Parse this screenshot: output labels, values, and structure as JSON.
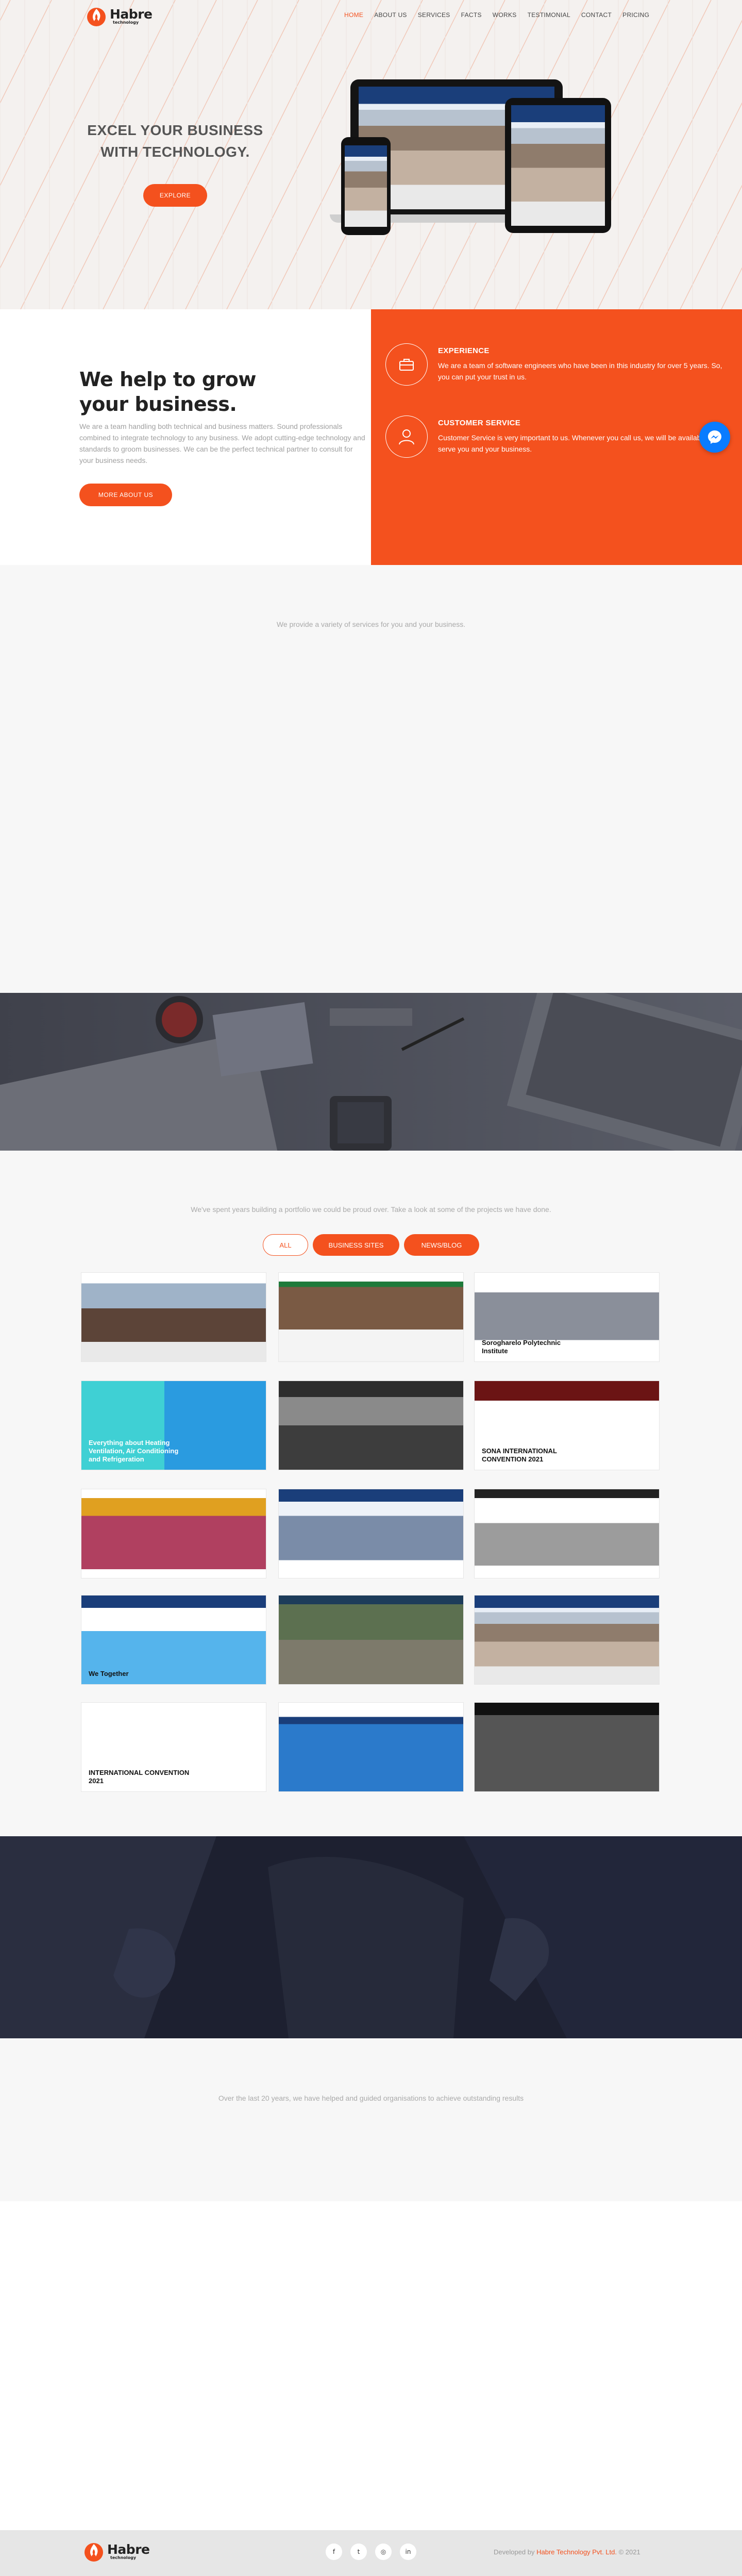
{
  "brand": {
    "name": "Habre",
    "subtitle": "technology",
    "accent_color": "#f4511e"
  },
  "nav": {
    "items": [
      {
        "label": "HOME",
        "active": true
      },
      {
        "label": "ABOUT US",
        "active": false
      },
      {
        "label": "SERVICES",
        "active": false
      },
      {
        "label": "FACTS",
        "active": false
      },
      {
        "label": "WORKS",
        "active": false
      },
      {
        "label": "TESTIMONIAL",
        "active": false
      },
      {
        "label": "CONTACT",
        "active": false
      },
      {
        "label": "PRICING",
        "active": false
      }
    ]
  },
  "hero": {
    "title_line1": "EXCEL YOUR BUSINESS",
    "title_line2": "WITH TECHNOLOGY.",
    "button_label": "EXPLORE"
  },
  "about": {
    "title_line1": "We help to grow",
    "title_line2": "your business.",
    "text": "We are a team handling both technical and business matters. Sound professionals combined to integrate technology to any business. We adopt cutting-edge technology and standards to groom businesses. We can be the perfect technical partner to consult for your business needs.",
    "button_label": "MORE ABOUT US",
    "features": [
      {
        "icon": "briefcase-icon",
        "title": "EXPERIENCE",
        "desc": "We are a team of software engineers who have been in this industry for over 5 years. So, you can put your trust in us."
      },
      {
        "icon": "user-icon",
        "title": "CUSTOMER SERVICE",
        "desc": "Customer Service is very important to us. Whenever you call us, we will be available to serve you and your business."
      }
    ]
  },
  "services": {
    "subtitle": "We provide a variety of services for you and your business."
  },
  "portfolio": {
    "subtitle": "We've spent years building a portfolio we could be proud over. Take a look at some of the projects we have done.",
    "filters": [
      {
        "label": "ALL",
        "active": false
      },
      {
        "label": "BUSINESS SITES",
        "active": true
      },
      {
        "label": "NEWS/BLOG",
        "active": true
      }
    ],
    "items": [
      {
        "caption": ""
      },
      {
        "caption": ""
      },
      {
        "caption": "Sorogharelo Polytechnic Institute"
      },
      {
        "caption": "Everything about Heating Ventilation, Air Conditioning and Refrigeration"
      },
      {
        "caption": ""
      },
      {
        "caption": "SONA INTERNATIONAL CONVENTION 2021"
      },
      {
        "caption": ""
      },
      {
        "caption": ""
      },
      {
        "caption": ""
      },
      {
        "caption": "We Together"
      },
      {
        "caption": ""
      },
      {
        "caption": ""
      },
      {
        "caption": "INTERNATIONAL CONVENTION 2021"
      },
      {
        "caption": ""
      },
      {
        "caption": ""
      }
    ]
  },
  "facts": {
    "subtitle": "Over the last 20 years, we have helped and guided organisations to achieve outstanding results"
  },
  "footer": {
    "socials": [
      "facebook-icon",
      "twitter-icon",
      "instagram-icon",
      "linkedin-icon"
    ],
    "social_glyphs": [
      "f",
      "t",
      "◎",
      "in"
    ],
    "copyright_prefix": "Developed by",
    "copyright_brand": "Habre Technology Pvt. Ltd.",
    "copyright_suffix": "© 2021"
  }
}
